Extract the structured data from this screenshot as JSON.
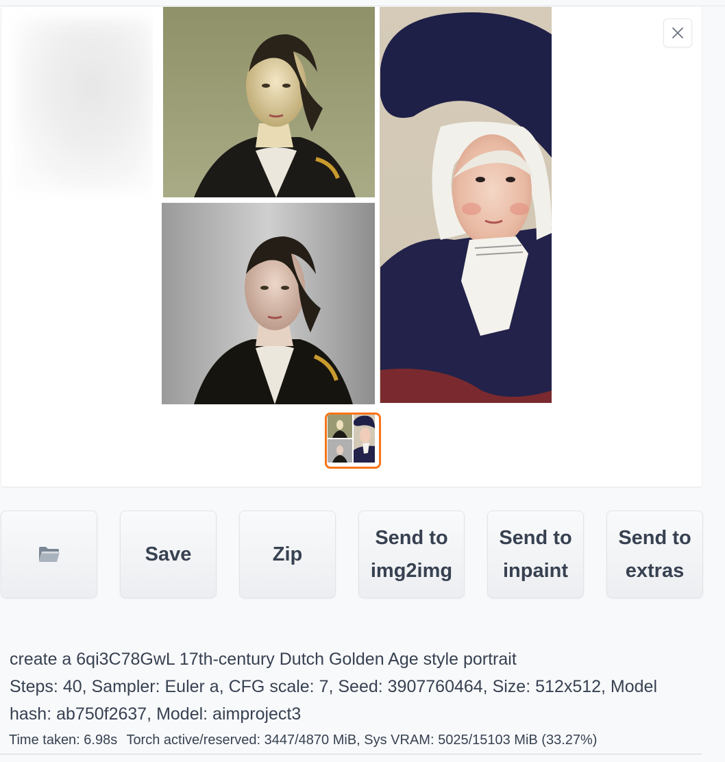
{
  "gallery": {
    "close_icon": "close-icon",
    "thumbnail_count": 1,
    "colors": {
      "selected_border": "#f97316"
    }
  },
  "buttons": {
    "open_folder_icon": "folder-icon",
    "save_label": "Save",
    "zip_label": "Zip",
    "send_img2img_line1": "Send to",
    "send_img2img_line2": "img2img",
    "send_inpaint_line1": "Send to",
    "send_inpaint_line2": "inpaint",
    "send_extras_line1": "Send to",
    "send_extras_line2": "extras"
  },
  "generation_info": {
    "prompt": "create a 6qi3C78GwL 17th-century Dutch Golden Age style portrait",
    "params_line1": "Steps: 40, Sampler: Euler a, CFG scale: 7, Seed: 3907760464, Size: 512x512, Model",
    "params_line2": "hash: ab750f2637, Model: aimproject3"
  },
  "timing": {
    "time_taken": "Time taken: 6.98s",
    "memory": "Torch active/reserved: 3447/4870 MiB, Sys VRAM: 5025/15103 MiB (33.27%)"
  }
}
